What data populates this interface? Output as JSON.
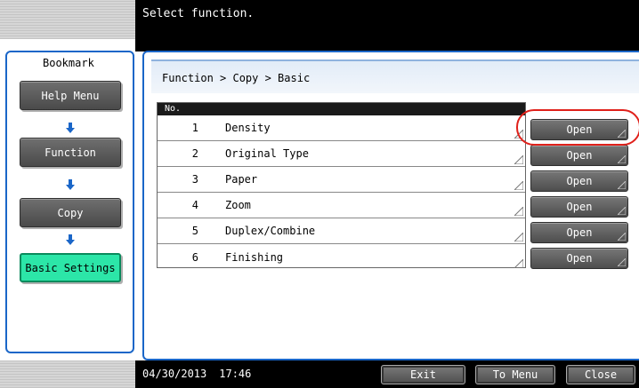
{
  "header": {
    "message": "Select function."
  },
  "bookmark": {
    "title": "Bookmark",
    "items": [
      {
        "label": "Help Menu"
      },
      {
        "label": "Function"
      },
      {
        "label": "Copy"
      },
      {
        "label": "Basic Settings",
        "active": true
      }
    ]
  },
  "breadcrumb": "Function > Copy > Basic",
  "table": {
    "header": "No.",
    "rows": [
      {
        "num": "1",
        "label": "Density",
        "button": "Open"
      },
      {
        "num": "2",
        "label": "Original Type",
        "button": "Open"
      },
      {
        "num": "3",
        "label": "Paper",
        "button": "Open"
      },
      {
        "num": "4",
        "label": "Zoom",
        "button": "Open"
      },
      {
        "num": "5",
        "label": "Duplex/Combine",
        "button": "Open"
      },
      {
        "num": "6",
        "label": "Finishing",
        "button": "Open"
      }
    ]
  },
  "footer": {
    "date": "04/30/2013",
    "time": "17:46",
    "exit_label": "Exit",
    "to_menu_label": "To Menu",
    "close_label": "Close"
  },
  "colors": {
    "accent_blue": "#1a66c8",
    "active_green": "#2ce6a8",
    "highlight_red": "#e0201a"
  },
  "icons": {
    "bookmark_arrow": "arrow-down-icon",
    "button_corner": "corner-triangle-icon"
  }
}
